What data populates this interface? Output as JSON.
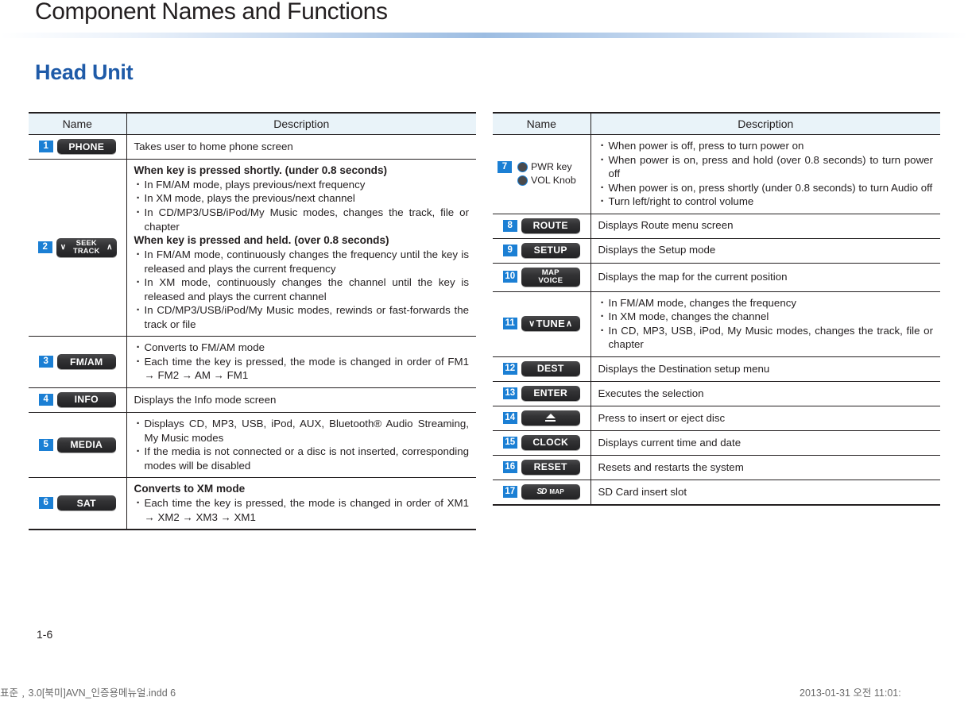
{
  "header": {
    "title": "Component Names and Functions"
  },
  "section": {
    "title": "Head Unit"
  },
  "table_headers": {
    "name": "Name",
    "description": "Description"
  },
  "left_table": {
    "rows": [
      {
        "num": "1",
        "key_label": "PHONE",
        "desc_plain": "Takes user to home phone screen"
      },
      {
        "num": "2",
        "key_line1": "SEEK",
        "key_line2": "TRACK",
        "chevron_left": "∨",
        "chevron_right": "∧",
        "heading_a": "When key is pressed shortly. (under 0.8 seconds)",
        "bullets_a": [
          "In FM/AM mode, plays previous/next frequency",
          "In XM mode, plays the previous/next channel",
          "In CD/MP3/USB/iPod/My Music modes, changes the track, file or chapter"
        ],
        "heading_b": "When key is pressed and held. (over 0.8 seconds)",
        "bullets_b": [
          "In FM/AM mode, continuously changes the frequency until the key is released and plays the current frequency",
          "In XM mode, continuously changes the channel until the key is released and plays the current channel",
          "In CD/MP3/USB/iPod/My Music modes, rewinds or fast-forwards the track or file"
        ]
      },
      {
        "num": "3",
        "key_label": "FM/AM",
        "bullets": [
          "Converts to FM/AM mode",
          "Each time the key is pressed, the mode is changed in order of FM1 → FM2 → AM → FM1"
        ]
      },
      {
        "num": "4",
        "key_label": "INFO",
        "desc_plain": "Displays the Info mode screen"
      },
      {
        "num": "5",
        "key_label": "MEDIA",
        "bullets": [
          "Displays CD, MP3, USB, iPod, AUX, Bluetooth® Audio Streaming, My Music modes",
          "If the media is not connected or a disc is not inserted, corresponding modes will be disabled"
        ]
      },
      {
        "num": "6",
        "key_label": "SAT",
        "heading": "Converts to XM mode",
        "bullets": [
          "Each time the key is pressed, the mode is changed in order of XM1 → XM2 → XM3 → XM1"
        ]
      }
    ]
  },
  "right_table": {
    "rows": [
      {
        "num": "7",
        "pwr_label": "PWR key",
        "vol_label": "VOL Knob",
        "bullets": [
          "When power is off, press to turn power on",
          "When power is on, press and hold (over 0.8 seconds) to turn power off",
          "When power is on, press shortly (under 0.8 seconds) to turn Audio off",
          "Turn left/right to control volume"
        ]
      },
      {
        "num": "8",
        "key_label": "ROUTE",
        "desc_plain": "Displays Route menu screen"
      },
      {
        "num": "9",
        "key_label": "SETUP",
        "desc_plain": "Displays the Setup mode"
      },
      {
        "num": "10",
        "key_line1": "MAP",
        "key_line2": "VOICE",
        "desc_plain": "Displays the map for the current position"
      },
      {
        "num": "11",
        "key_label": "TUNE",
        "chevron_left": "∨",
        "chevron_right": "∧",
        "bullets": [
          "In FM/AM mode, changes the frequency",
          "In XM mode, changes the channel",
          "In CD, MP3, USB, iPod, My Music modes, changes the track, file or chapter"
        ]
      },
      {
        "num": "12",
        "key_label": "DEST",
        "desc_plain": "Displays the Destination setup menu"
      },
      {
        "num": "13",
        "key_label": "ENTER",
        "desc_plain": "Executes the selection"
      },
      {
        "num": "14",
        "key_icon": "eject-icon",
        "desc_plain": "Press to insert or eject disc"
      },
      {
        "num": "15",
        "key_label": "CLOCK",
        "desc_plain": "Displays current time and date"
      },
      {
        "num": "16",
        "key_label": "RESET",
        "desc_plain": "Resets and restarts the system"
      },
      {
        "num": "17",
        "key_sd_logo": "SD",
        "key_sd_map": "MAP",
        "desc_plain": "SD Card insert slot"
      }
    ]
  },
  "footer": {
    "page_number": "1-6",
    "file_name": "표준﹐3.0[북미]AVN_인증용메뉴얼.indd   6",
    "date": "2013-01-31   오전 11:01:"
  },
  "colors": {
    "accent_blue": "#1b7fd4",
    "section_blue": "#1f5ba8",
    "table_header_bg": "#e9f3f9",
    "key_dark": "#333335",
    "text": "#231f20"
  }
}
